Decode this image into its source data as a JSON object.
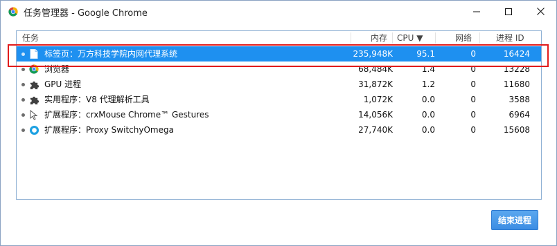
{
  "window": {
    "title": "任务管理器 - Google Chrome",
    "icon": "chrome-icon",
    "controls": {
      "minimize_icon": "minimize-icon",
      "maximize_icon": "maximize-icon",
      "close_icon": "close-icon"
    }
  },
  "table": {
    "columns": {
      "task": "任务",
      "memory": "内存",
      "cpu": "CPU ▼",
      "network": "网络",
      "process_id": "进程 ID"
    },
    "rows": [
      {
        "icon": "page-icon",
        "name": "标签页：万方科技学院内网代理系统",
        "memory": "235,948K",
        "cpu": "95.1",
        "network": "0",
        "process_id": "16424",
        "selected": true
      },
      {
        "icon": "chrome-icon",
        "name": "浏览器",
        "memory": "68,484K",
        "cpu": "1.4",
        "network": "0",
        "process_id": "13228",
        "selected": false
      },
      {
        "icon": "puzzle-icon",
        "name": "GPU 进程",
        "memory": "31,872K",
        "cpu": "1.2",
        "network": "0",
        "process_id": "11680",
        "selected": false
      },
      {
        "icon": "puzzle-icon",
        "name": "实用程序：V8 代理解析工具",
        "memory": "1,072K",
        "cpu": "0.0",
        "network": "0",
        "process_id": "3588",
        "selected": false
      },
      {
        "icon": "cursor-icon",
        "name": "扩展程序：crxMouse Chrome™ Gestures",
        "memory": "14,056K",
        "cpu": "0.0",
        "network": "0",
        "process_id": "6964",
        "selected": false
      },
      {
        "icon": "proxy-switchyomega-icon",
        "name": "扩展程序：Proxy SwitchyOmega",
        "memory": "27,740K",
        "cpu": "0.0",
        "network": "0",
        "process_id": "15608",
        "selected": false
      }
    ]
  },
  "footer": {
    "end_process_label": "结束进程"
  },
  "colors": {
    "selection": "#1e90f0",
    "highlight_box": "#e11b1b",
    "button": "#3c8de3"
  }
}
